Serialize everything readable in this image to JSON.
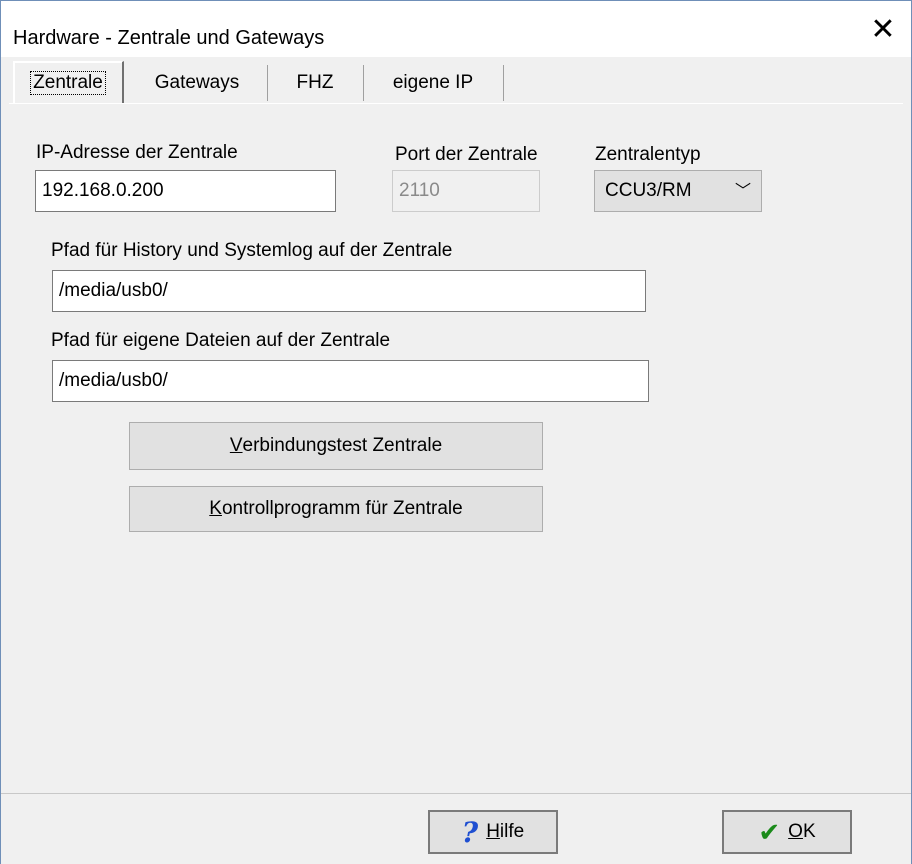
{
  "window": {
    "title": "Hardware  -  Zentrale und Gateways",
    "close_icon": "close-icon"
  },
  "tabs": [
    {
      "label": "Zentrale",
      "active": true
    },
    {
      "label": "Gateways",
      "active": false
    },
    {
      "label": "FHZ",
      "active": false
    },
    {
      "label": "eigene IP",
      "active": false
    }
  ],
  "form": {
    "ip_label": "IP-Adresse der Zentrale",
    "ip_value": "192.168.0.200",
    "port_label": "Port der Zentrale",
    "port_value": "2110",
    "type_label": "Zentralentyp",
    "type_value": "CCU3/RM",
    "history_label": "Pfad für History und Systemlog auf der Zentrale",
    "history_value": "/media/usb0/",
    "files_label": "Pfad für eigene Dateien auf der Zentrale",
    "files_value": "/media/usb0/"
  },
  "buttons": {
    "test_first": "V",
    "test_rest": "erbindungstest Zentrale",
    "control_first": "K",
    "control_rest": "ontrollprogramm für Zentrale"
  },
  "footer": {
    "help_first": "H",
    "help_rest": "ilfe",
    "ok_first": "O",
    "ok_rest": "K"
  }
}
